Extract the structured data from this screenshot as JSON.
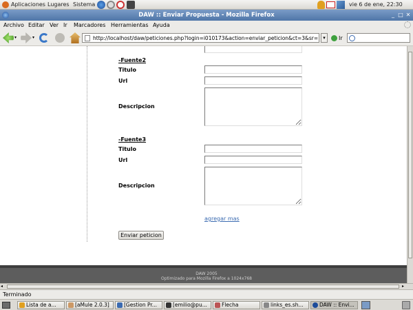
{
  "top_panel": {
    "menus": [
      "Aplicaciones",
      "Lugares",
      "Sistema"
    ],
    "clock": "vie  6 de ene, 22:30"
  },
  "window": {
    "title": "DAW :: Enviar Propuesta - Mozilla Firefox"
  },
  "menubar": {
    "items": [
      "Archivo",
      "Editar",
      "Ver",
      "Ir",
      "Marcadores",
      "Herramientas",
      "Ayuda"
    ]
  },
  "navbar": {
    "url": "http://localhost/daw/peticiones.php?login=i010173&action=enviar_peticion&ct=3&sr=",
    "go_label": "Ir",
    "search_value": ""
  },
  "form": {
    "sections": [
      {
        "heading": "-Fuente2",
        "titulo_label": "Titulo",
        "url_label": "Url",
        "descripcion_label": "Descripcion"
      },
      {
        "heading": "-Fuente3",
        "titulo_label": "Titulo",
        "url_label": "Url",
        "descripcion_label": "Descripcion"
      }
    ],
    "add_more_label": "agregar mas",
    "submit_label": "Enviar peticion"
  },
  "footer": {
    "line1": "DAW 2005",
    "line2": "Optimizado para Mozilla Firefox a 1024x768"
  },
  "status": {
    "text": "Terminado"
  },
  "taskbar": {
    "items": [
      "Lista de a...",
      "[aMule 2.0.3]",
      "[Gestion Pr...",
      "[emilio@pu...",
      "Flecha",
      "links_es.sh...",
      "DAW :: Envi..."
    ]
  },
  "colors": {
    "titlebar": "#5b80b1",
    "link": "#3b6bb1",
    "footer": "#5d5d5d"
  }
}
